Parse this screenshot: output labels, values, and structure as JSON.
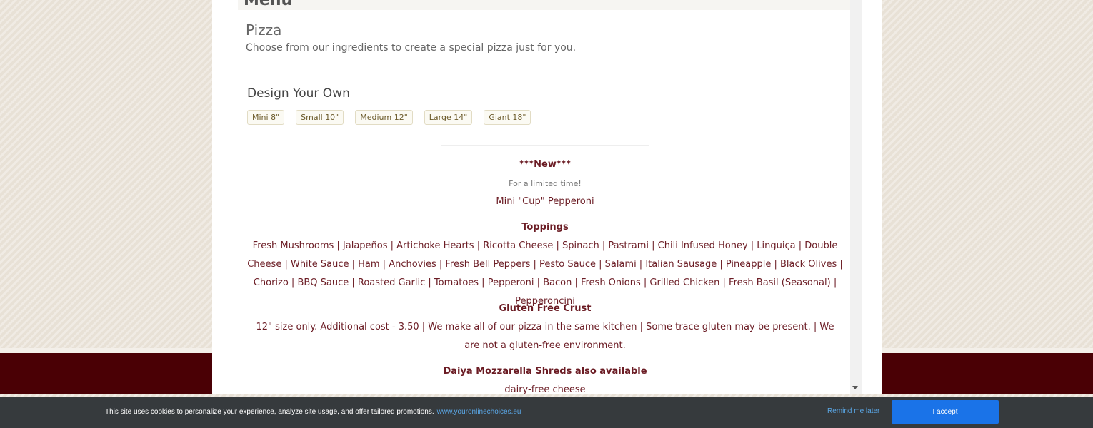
{
  "menu": {
    "heading": "Menu"
  },
  "pizza": {
    "title": "Pizza",
    "subtitle": "Choose from our ingredients to create a special pizza just for you."
  },
  "design": {
    "title": "Design Your Own",
    "sizes": [
      "Mini 8\"",
      "Small 10\"",
      "Medium 12\"",
      "Large 14\"",
      "Giant 18\""
    ]
  },
  "new_item": {
    "heading": "***New***",
    "note": "For a limited time!",
    "name": "Mini \"Cup\" Pepperoni"
  },
  "toppings": {
    "heading": "Toppings",
    "text": "Fresh Mushrooms | Jalapeños | Artichoke Hearts | Ricotta Cheese | Spinach | Pastrami | Chili Infused Honey | Linguiça | Double Cheese | White Sauce | Ham | Anchovies | Fresh Bell Peppers | Pesto Sauce | Salami | Italian Sausage | Pineapple | Black Olives | Chorizo | BBQ Sauce | Roasted Garlic | Tomatoes | Pepperoni | Bacon | Fresh Onions | Grilled Chicken | Fresh Basil (Seasonal) | Pepperoncini"
  },
  "gluten": {
    "heading": "Gluten Free Crust",
    "text": "12\" size only. Additional cost - 3.50 | We make all of our pizza in the same kitchen | Some trace gluten may be present. | We are not a gluten-free environment."
  },
  "daiya": {
    "heading": "Daiya Mozzarella Shreds also available",
    "text": "dairy-free cheese"
  },
  "cookie": {
    "message": "This site uses cookies to personalize your experience, analyze site usage, and offer tailored promotions.",
    "link": "www.youronlinechoices.eu",
    "remind": "Remind me later",
    "accept": "I accept"
  }
}
